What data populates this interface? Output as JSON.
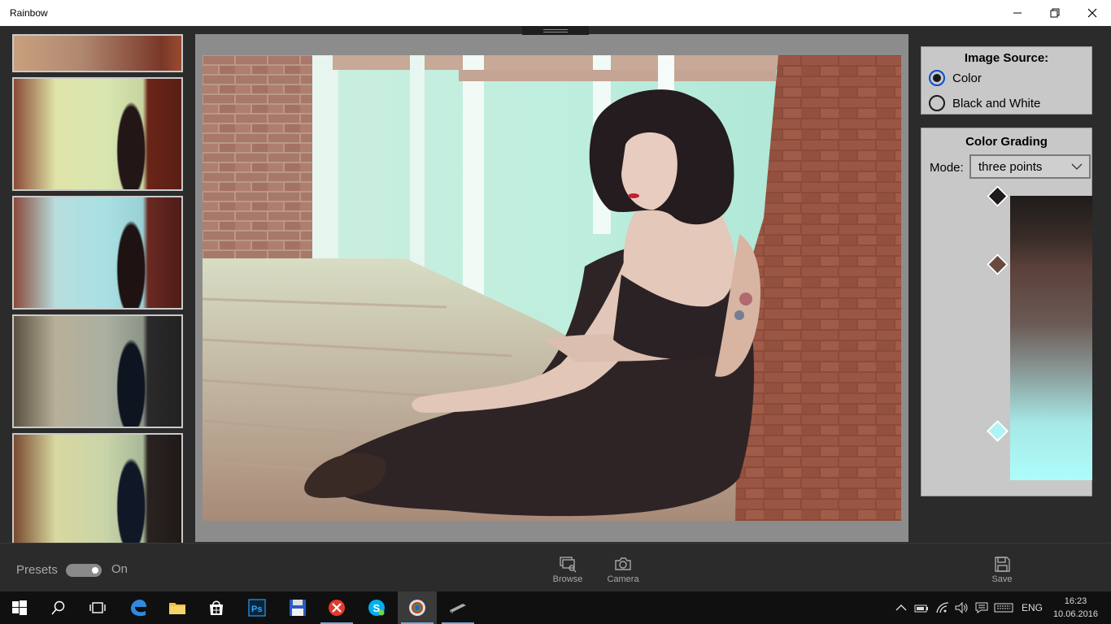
{
  "window": {
    "title": "Rainbow"
  },
  "image_source": {
    "heading": "Image Source:",
    "options": [
      {
        "label": "Color",
        "selected": true
      },
      {
        "label": "Black and White",
        "selected": false
      }
    ]
  },
  "color_grading": {
    "heading": "Color Grading",
    "mode_label": "Mode:",
    "mode_value": "three points",
    "points": [
      {
        "color": "#1e1b1a"
      },
      {
        "color": "#6a4a3e"
      },
      {
        "color": "#adf5f3"
      }
    ]
  },
  "bottom_bar": {
    "presets_label": "Presets",
    "toggle_state": "On",
    "browse_label": "Browse",
    "camera_label": "Camera",
    "save_label": "Save"
  },
  "taskbar": {
    "language": "ENG",
    "time": "16:23",
    "date": "10.06.2016"
  },
  "colors": {
    "accent": "#0050c8",
    "panel": "#c8c8c8",
    "background": "#2b2b2b"
  }
}
